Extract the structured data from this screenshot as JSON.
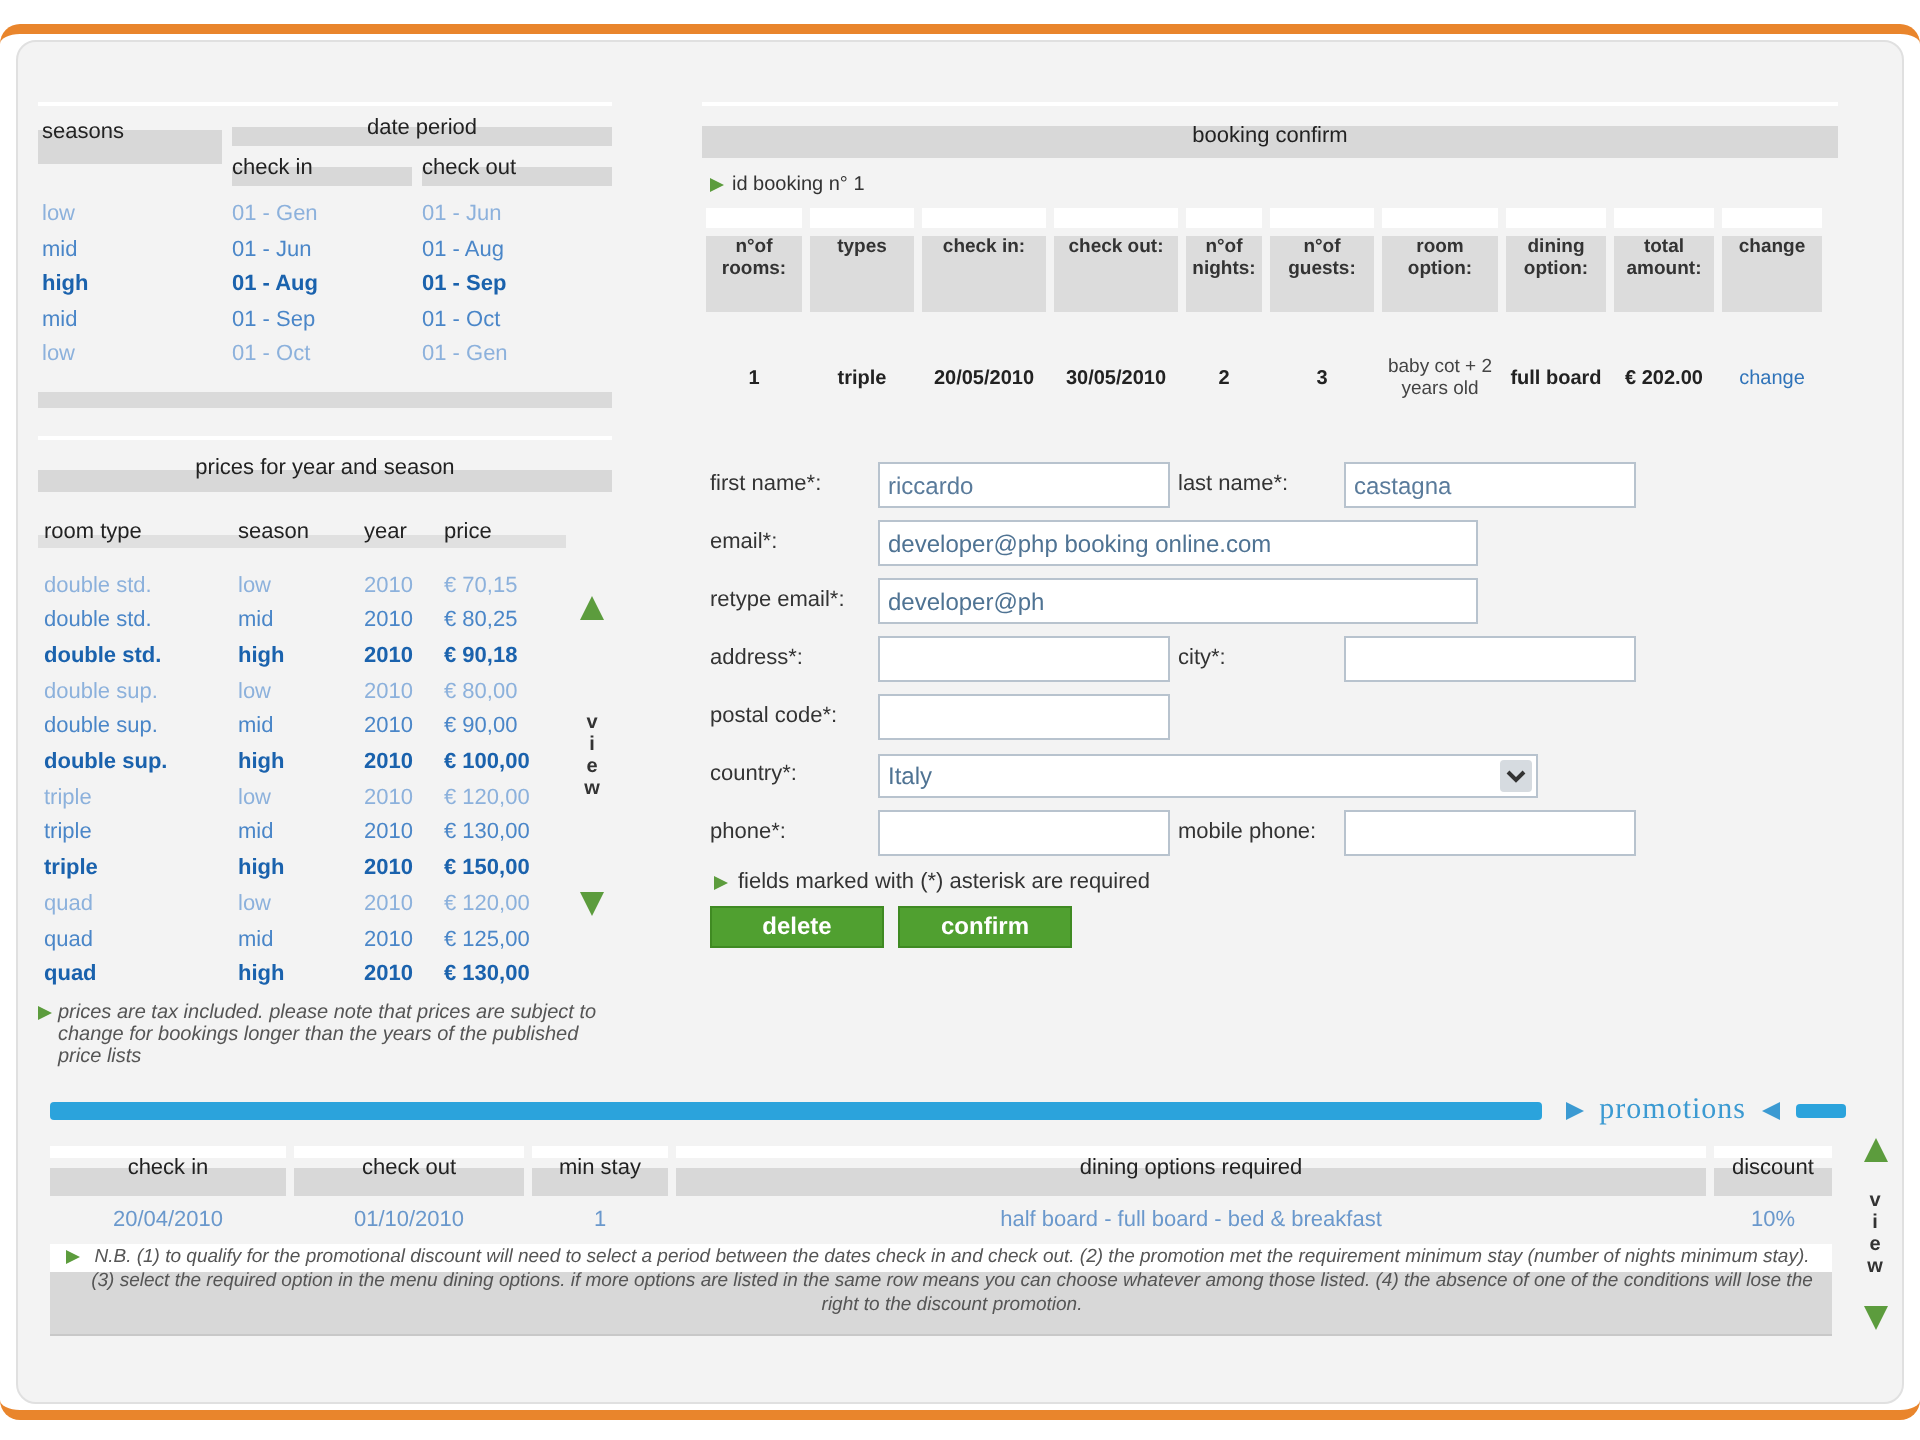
{
  "seasons": {
    "header": "seasons",
    "group_header": "date period",
    "columns": [
      "check in",
      "check out"
    ],
    "rows": [
      {
        "kind": "low",
        "season": "low",
        "check_in": "01 - Gen",
        "check_out": "01 - Jun"
      },
      {
        "kind": "mid",
        "season": "mid",
        "check_in": "01 - Jun",
        "check_out": "01 - Aug"
      },
      {
        "kind": "high",
        "season": "high",
        "check_in": "01 - Aug",
        "check_out": "01 - Sep"
      },
      {
        "kind": "mid",
        "season": "mid",
        "check_in": "01 - Sep",
        "check_out": "01 - Oct"
      },
      {
        "kind": "low",
        "season": "low",
        "check_in": "01 - Oct",
        "check_out": "01 - Gen"
      }
    ]
  },
  "prices": {
    "title": "prices for year and season",
    "columns": [
      "room type",
      "season",
      "year",
      "price"
    ],
    "rows": [
      {
        "kind": "low",
        "room_type": "double std.",
        "season": "low",
        "year": "2010",
        "price": "€ 70,15"
      },
      {
        "kind": "mid",
        "room_type": "double std.",
        "season": "mid",
        "year": "2010",
        "price": "€ 80,25"
      },
      {
        "kind": "high",
        "room_type": "double std.",
        "season": "high",
        "year": "2010",
        "price": "€ 90,18"
      },
      {
        "kind": "low",
        "room_type": "double sup.",
        "season": "low",
        "year": "2010",
        "price": "€ 80,00"
      },
      {
        "kind": "mid",
        "room_type": "double sup.",
        "season": "mid",
        "year": "2010",
        "price": "€ 90,00"
      },
      {
        "kind": "high",
        "room_type": "double sup.",
        "season": "high",
        "year": "2010",
        "price": "€ 100,00"
      },
      {
        "kind": "low",
        "room_type": "triple",
        "season": "low",
        "year": "2010",
        "price": "€ 120,00"
      },
      {
        "kind": "mid",
        "room_type": "triple",
        "season": "mid",
        "year": "2010",
        "price": "€ 130,00"
      },
      {
        "kind": "high",
        "room_type": "triple",
        "season": "high",
        "year": "2010",
        "price": "€ 150,00"
      },
      {
        "kind": "low",
        "room_type": "quad",
        "season": "low",
        "year": "2010",
        "price": "€ 120,00"
      },
      {
        "kind": "mid",
        "room_type": "quad",
        "season": "mid",
        "year": "2010",
        "price": "€ 125,00"
      },
      {
        "kind": "high",
        "room_type": "quad",
        "season": "high",
        "year": "2010",
        "price": "€ 130,00"
      }
    ],
    "scroller": "view",
    "note": "prices are tax included. please note that prices are subject to change for bookings longer than the years of the published price lists"
  },
  "booking": {
    "title": "booking confirm",
    "id_label": "id booking n° 1",
    "columns": [
      "n°of rooms:",
      "types",
      "check in:",
      "check out:",
      "n°of nights:",
      "n°of guests:",
      "room option:",
      "dining option:",
      "total amount:",
      "change"
    ],
    "cells": [
      {
        "kind": "bold",
        "text": "1"
      },
      {
        "kind": "bold",
        "text": "triple"
      },
      {
        "kind": "bold",
        "text": "20/05/2010"
      },
      {
        "kind": "bold",
        "text": "30/05/2010"
      },
      {
        "kind": "bold",
        "text": "2"
      },
      {
        "kind": "bold",
        "text": "3"
      },
      {
        "kind": "plain",
        "text": "baby cot + 2 years old"
      },
      {
        "kind": "bold",
        "text": "full board"
      },
      {
        "kind": "bold",
        "text": "€ 202.00"
      },
      {
        "kind": "link",
        "text": "change"
      }
    ]
  },
  "form": {
    "rows": [
      {
        "fields": [
          {
            "kind": "short",
            "label": "first name*:",
            "value": "riccardo"
          },
          {
            "kind": "short",
            "label": "last name*:",
            "value": "castagna"
          }
        ]
      },
      {
        "fields": [
          {
            "kind": "long",
            "label": "email*:",
            "value": "developer@php booking online.com"
          }
        ]
      },
      {
        "fields": [
          {
            "kind": "long",
            "label": "retype email*:",
            "value": "developer@ph"
          }
        ]
      },
      {
        "fields": [
          {
            "kind": "short",
            "label": "address*:"
          },
          {
            "kind": "short",
            "label": "city*:"
          }
        ]
      },
      {
        "fields": [
          {
            "kind": "short",
            "label": "postal code*:"
          }
        ]
      },
      {
        "fields": [
          {
            "kind": "select",
            "label": "country*:",
            "value": "Italy"
          }
        ]
      },
      {
        "fields": [
          {
            "kind": "short",
            "label": "phone*:"
          },
          {
            "kind": "short",
            "label": "mobile phone:"
          }
        ]
      }
    ],
    "note": "fields marked with (*) asterisk are required",
    "buttons": [
      "delete",
      "confirm"
    ]
  },
  "promotions": {
    "title": "promotions",
    "columns": [
      "check in",
      "check out",
      "min stay",
      "dining options required",
      "discount"
    ],
    "rows": [
      {
        "check_in": "20/04/2010",
        "check_out": "01/10/2010",
        "min_stay": "1",
        "dining_options": "half board - full board - bed & breakfast",
        "discount": "10%"
      }
    ],
    "scroller": "view",
    "note": "N.B. (1) to qualify for the promotional discount will need to select a period between the dates check in and check out. (2) the promotion met the requirement minimum stay (number of nights minimum stay). (3) select the required option in the menu dining options. if more options are listed in the same row means you can choose whatever among those listed. (4) the absence of one of the conditions will lose the right to the discount promotion."
  }
}
